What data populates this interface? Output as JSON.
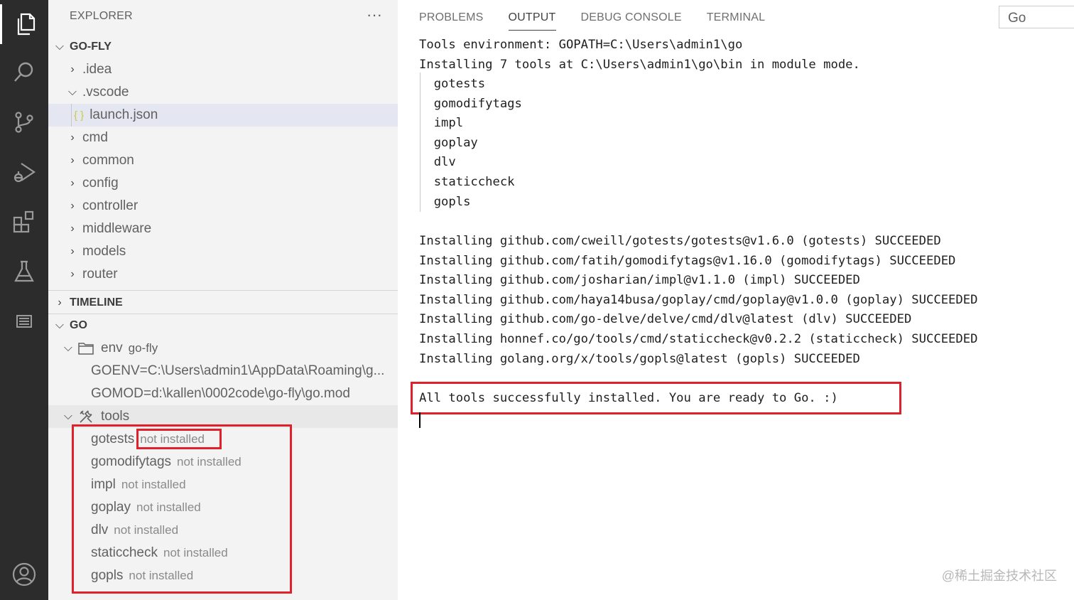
{
  "activity_bar": {
    "icons": [
      "explorer-icon",
      "search-icon",
      "source-control-icon",
      "run-debug-icon",
      "extensions-icon",
      "testing-icon",
      "output-list-icon",
      "account-icon"
    ]
  },
  "sidebar": {
    "header": "EXPLORER",
    "more": "···",
    "workspace": "GO-FLY",
    "tree": {
      "idea": ".idea",
      "vscode": ".vscode",
      "launch_json_icon": "{ }",
      "launch_json": "launch.json",
      "cmd": "cmd",
      "common": "common",
      "config": "config",
      "controller": "controller",
      "middleware": "middleware",
      "models": "models",
      "router": "router"
    },
    "timeline": "TIMELINE",
    "go_section": "GO",
    "env_label": "env",
    "env_value": "go-fly",
    "goenv": "GOENV=C:\\Users\\admin1\\AppData\\Roaming\\g...",
    "gomod": "GOMOD=d:\\kallen\\0002code\\go-fly\\go.mod",
    "tools_label": "tools",
    "tools": [
      {
        "name": "gotests",
        "status": "not installed"
      },
      {
        "name": "gomodifytags",
        "status": "not installed"
      },
      {
        "name": "impl",
        "status": "not installed"
      },
      {
        "name": "goplay",
        "status": "not installed"
      },
      {
        "name": "dlv",
        "status": "not installed"
      },
      {
        "name": "staticcheck",
        "status": "not installed"
      },
      {
        "name": "gopls",
        "status": "not installed"
      }
    ]
  },
  "panel": {
    "tabs": [
      "PROBLEMS",
      "OUTPUT",
      "DEBUG CONSOLE",
      "TERMINAL"
    ],
    "active_tab": "OUTPUT",
    "channel": "Go",
    "lines": [
      "Tools environment: GOPATH=C:\\Users\\admin1\\go",
      "Installing 7 tools at C:\\Users\\admin1\\go\\bin in module mode.",
      "  gotests",
      "  gomodifytags",
      "  impl",
      "  goplay",
      "  dlv",
      "  staticcheck",
      "  gopls",
      "",
      "Installing github.com/cweill/gotests/gotests@v1.6.0 (gotests) SUCCEEDED",
      "Installing github.com/fatih/gomodifytags@v1.16.0 (gomodifytags) SUCCEEDED",
      "Installing github.com/josharian/impl@v1.1.0 (impl) SUCCEEDED",
      "Installing github.com/haya14busa/goplay/cmd/goplay@v1.0.0 (goplay) SUCCEEDED",
      "Installing github.com/go-delve/delve/cmd/dlv@latest (dlv) SUCCEEDED",
      "Installing honnef.co/go/tools/cmd/staticcheck@v0.2.2 (staticcheck) SUCCEEDED",
      "Installing golang.org/x/tools/gopls@latest (gopls) SUCCEEDED",
      "",
      "All tools successfully installed. You are ready to Go. :)"
    ]
  },
  "watermark": "@稀土掘金技术社区",
  "colors": {
    "activity_bg": "#2c2c2c",
    "sidebar_bg": "#f3f3f3",
    "highlight_red": "#e0202a"
  }
}
